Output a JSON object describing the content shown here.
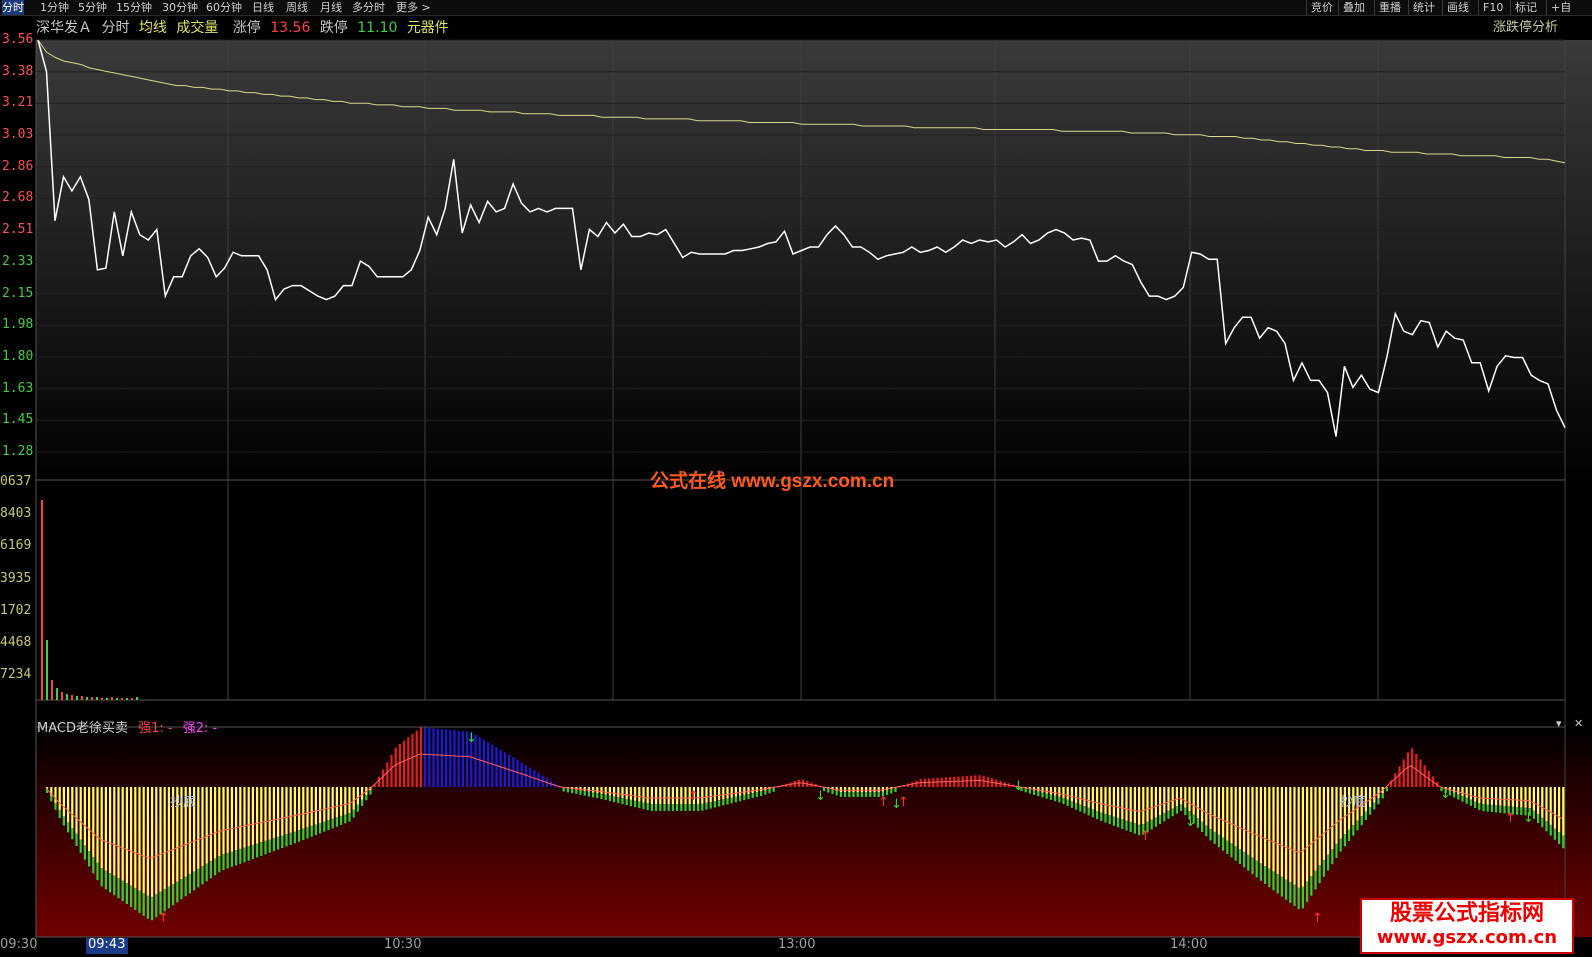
{
  "toolbar": {
    "tabs": [
      "分时",
      "1分钟",
      "5分钟",
      "15分钟",
      "30分钟",
      "60分钟",
      "日线",
      "周线",
      "月线",
      "多分时",
      "更多 >"
    ],
    "right_buttons": [
      "竞价",
      "叠加",
      "重播",
      "统计",
      "画线",
      "F10",
      "标记",
      "+自"
    ]
  },
  "header": {
    "stock_name": "深华发Ａ",
    "mode": "分时",
    "avg_line_label": "均线",
    "volume_label": "成交量",
    "limit_up_label": "涨停",
    "limit_up_value": "13.56",
    "limit_down_label": "跌停",
    "limit_down_value": "11.10",
    "sector": "元器件",
    "right_title": "涨跌停分析"
  },
  "price_axis": [
    "3.56",
    "3.38",
    "3.21",
    "3.03",
    "2.86",
    "2.68",
    "2.51",
    "2.33",
    "2.15",
    "1.98",
    "1.80",
    "1.63",
    "1.45",
    "1.28"
  ],
  "volume_axis": [
    "0637",
    "8403",
    "6169",
    "3935",
    "1702",
    "4468",
    "7234"
  ],
  "macd": {
    "title": "MACD老徐买卖",
    "strong1": "强1: -",
    "strong2": "强2: -",
    "bottom_label": "抄底"
  },
  "time_axis": {
    "labels": [
      "09:30",
      "10:30",
      "13:00",
      "14:00"
    ],
    "cursor_time": "09:43"
  },
  "watermark": {
    "center": "公式在线  www.gszx.com.cn",
    "corner_line1": "股票公式指标网",
    "corner_line2": "www.gszx.com.cn"
  },
  "colors": {
    "price_line": "#ffffff",
    "avg_line": "#d8d890",
    "up": "#ff4040",
    "down": "#40d040",
    "macd_yellow": "#ffff66",
    "macd_blue": "#1a1ad8",
    "macd_red": "#e02020",
    "macd_green": "#30d030"
  },
  "chart_data": {
    "type": "line",
    "title": "",
    "ylim": [
      1.28,
      3.56
    ],
    "series": [
      {
        "values": [
          3.56,
          3.38,
          2.53,
          2.78,
          2.7,
          2.78,
          2.65,
          2.25,
          2.26,
          2.58,
          2.33,
          2.58,
          2.45,
          2.42,
          2.48,
          2.1,
          2.21,
          2.21,
          2.33,
          2.37,
          2.32,
          2.21,
          2.26,
          2.35,
          2.33,
          2.33,
          2.33,
          2.25,
          2.08,
          2.14,
          2.16,
          2.16,
          2.13,
          2.1,
          2.08,
          2.1,
          2.16,
          2.16,
          2.3,
          2.27,
          2.21,
          2.21,
          2.21,
          2.21,
          2.25,
          2.36,
          2.55,
          2.45,
          2.6,
          2.88,
          2.46,
          2.62,
          2.52,
          2.64,
          2.58,
          2.6,
          2.74,
          2.63,
          2.58,
          2.6,
          2.58,
          2.6,
          2.6,
          2.6,
          2.25,
          2.48,
          2.44,
          2.52,
          2.46,
          2.51,
          2.44,
          2.44,
          2.46,
          2.45,
          2.48,
          2.4,
          2.32,
          2.35,
          2.34,
          2.34,
          2.34,
          2.34,
          2.36,
          2.36,
          2.37,
          2.38,
          2.4,
          2.41,
          2.47,
          2.34,
          2.36,
          2.38,
          2.38,
          2.45,
          2.5,
          2.45,
          2.38,
          2.38,
          2.35,
          2.31,
          2.33,
          2.34,
          2.35,
          2.38,
          2.35,
          2.36,
          2.38,
          2.35,
          2.38,
          2.42,
          2.4,
          2.42,
          2.41,
          2.42,
          2.38,
          2.41,
          2.45,
          2.4,
          2.42,
          2.46,
          2.48,
          2.46,
          2.42,
          2.43,
          2.42,
          2.3,
          2.3,
          2.33,
          2.3,
          2.28,
          2.18,
          2.1,
          2.1,
          2.08,
          2.1,
          2.15,
          2.35,
          2.34,
          2.31,
          2.31,
          1.83,
          1.92,
          1.98,
          1.98,
          1.86,
          1.92,
          1.9,
          1.83,
          1.62,
          1.72,
          1.62,
          1.62,
          1.55,
          1.3,
          1.7,
          1.58,
          1.65,
          1.57,
          1.55,
          1.75,
          2.0,
          1.9,
          1.88,
          1.96,
          1.95,
          1.81,
          1.9,
          1.86,
          1.85,
          1.72,
          1.72,
          1.56,
          1.7,
          1.76,
          1.75,
          1.75,
          1.65,
          1.62,
          1.6,
          1.45,
          1.35
        ],
        "name": ""
      },
      {
        "values": [
          3.56,
          3.49,
          3.46,
          3.44,
          3.43,
          3.42,
          3.4,
          3.39,
          3.38,
          3.37,
          3.36,
          3.35,
          3.34,
          3.33,
          3.32,
          3.31,
          3.3,
          3.3,
          3.29,
          3.29,
          3.28,
          3.28,
          3.27,
          3.27,
          3.26,
          3.26,
          3.25,
          3.25,
          3.24,
          3.24,
          3.23,
          3.23,
          3.22,
          3.22,
          3.21,
          3.21,
          3.2,
          3.2,
          3.2,
          3.19,
          3.19,
          3.19,
          3.18,
          3.18,
          3.18,
          3.17,
          3.17,
          3.17,
          3.16,
          3.16,
          3.16,
          3.16,
          3.15,
          3.15,
          3.15,
          3.15,
          3.14,
          3.14,
          3.14,
          3.14,
          3.13,
          3.13,
          3.13,
          3.13,
          3.13,
          3.12,
          3.12,
          3.12,
          3.12,
          3.12,
          3.11,
          3.11,
          3.11,
          3.11,
          3.11,
          3.11,
          3.1,
          3.1,
          3.1,
          3.1,
          3.1,
          3.1,
          3.09,
          3.09,
          3.09,
          3.09,
          3.09,
          3.09,
          3.08,
          3.08,
          3.08,
          3.08,
          3.08,
          3.08,
          3.08,
          3.07,
          3.07,
          3.07,
          3.07,
          3.07,
          3.07,
          3.06,
          3.06,
          3.06,
          3.06,
          3.06,
          3.06,
          3.06,
          3.06,
          3.05,
          3.05,
          3.05,
          3.05,
          3.05,
          3.05,
          3.05,
          3.05,
          3.05,
          3.04,
          3.04,
          3.04,
          3.04,
          3.04,
          3.04,
          3.04,
          3.04,
          3.03,
          3.03,
          3.03,
          3.03,
          3.03,
          3.02,
          3.02,
          3.02,
          3.02,
          3.01,
          3.01,
          3.01,
          3.01,
          3.0,
          3.0,
          2.99,
          2.99,
          2.98,
          2.98,
          2.97,
          2.97,
          2.96,
          2.96,
          2.95,
          2.95,
          2.94,
          2.94,
          2.93,
          2.93,
          2.93,
          2.92,
          2.92,
          2.92,
          2.92,
          2.91,
          2.91,
          2.91,
          2.91,
          2.9,
          2.9,
          2.9,
          2.9,
          2.9,
          2.89,
          2.89,
          2.89,
          2.89,
          2.88,
          2.88,
          2.87,
          2.86
        ],
        "name": ""
      }
    ]
  }
}
